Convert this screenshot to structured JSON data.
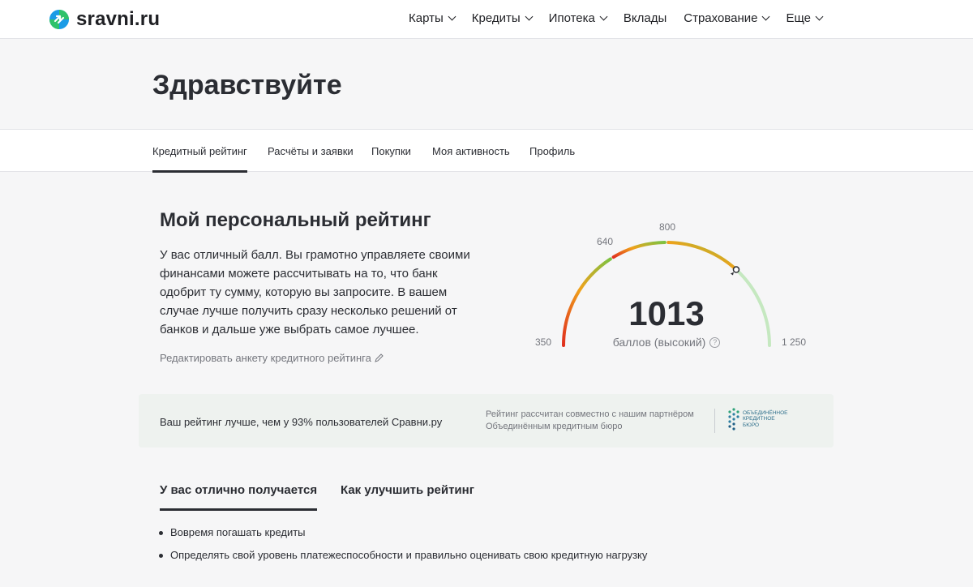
{
  "header": {
    "logo_text": "sravni.ru",
    "nav": [
      {
        "label": "Карты",
        "has_dropdown": true
      },
      {
        "label": "Кредиты",
        "has_dropdown": true
      },
      {
        "label": "Ипотека",
        "has_dropdown": true
      },
      {
        "label": "Вклады",
        "has_dropdown": false
      },
      {
        "label": "Страхование",
        "has_dropdown": true
      },
      {
        "label": "Еще",
        "has_dropdown": true
      }
    ]
  },
  "greeting": {
    "title": "Здравствуйте"
  },
  "tabs": [
    {
      "label": "Кредитный рейтинг",
      "active": true
    },
    {
      "label": "Расчёты и заявки",
      "active": false
    },
    {
      "label": "Покупки",
      "active": false
    },
    {
      "label": "Моя активность",
      "active": false
    },
    {
      "label": "Профиль",
      "active": false
    }
  ],
  "rating": {
    "title": "Мой персональный рейтинг",
    "description": "У вас отличный балл. Вы грамотно управляете своими финансами можете рассчитывать на то, что банк одобрит ту сумму, которую вы запросите. В вашем случае лучше получить сразу несколько решений от банков и дальше уже выбрать самое лучшее.",
    "edit_link": "Редактировать анкету кредитного рейтинга",
    "score": "1013",
    "score_label": "баллов (высокий)",
    "help_mark": "?",
    "gauge": {
      "min": 350,
      "max": 1250,
      "value": 1013,
      "ticks": {
        "min": "350",
        "t1": "640",
        "t2": "800",
        "max": "1 250"
      },
      "colors": {
        "low": "#e0301e",
        "mid": "#f0a21b",
        "high": "#7cc242",
        "top": "#c5e8c0"
      }
    }
  },
  "banner": {
    "compare_text": "Ваш рейтинг лучше, чем у 93% пользователей Сравни.ру",
    "partner_text": "Рейтинг рассчитан совместно с нашим партнёром Объединённым кредитным бюро",
    "partner_logo_text": "ОБЪЕДИНЁННОЕ КРЕДИТНОЕ БЮРО"
  },
  "subtabs": [
    {
      "label": "У вас отлично получается",
      "active": true
    },
    {
      "label": "Как улучшить рейтинг",
      "active": false
    }
  ],
  "tips": [
    "Вовремя погашать кредиты",
    "Определять свой уровень платежеспособности и правильно оценивать свою кредитную нагрузку"
  ]
}
